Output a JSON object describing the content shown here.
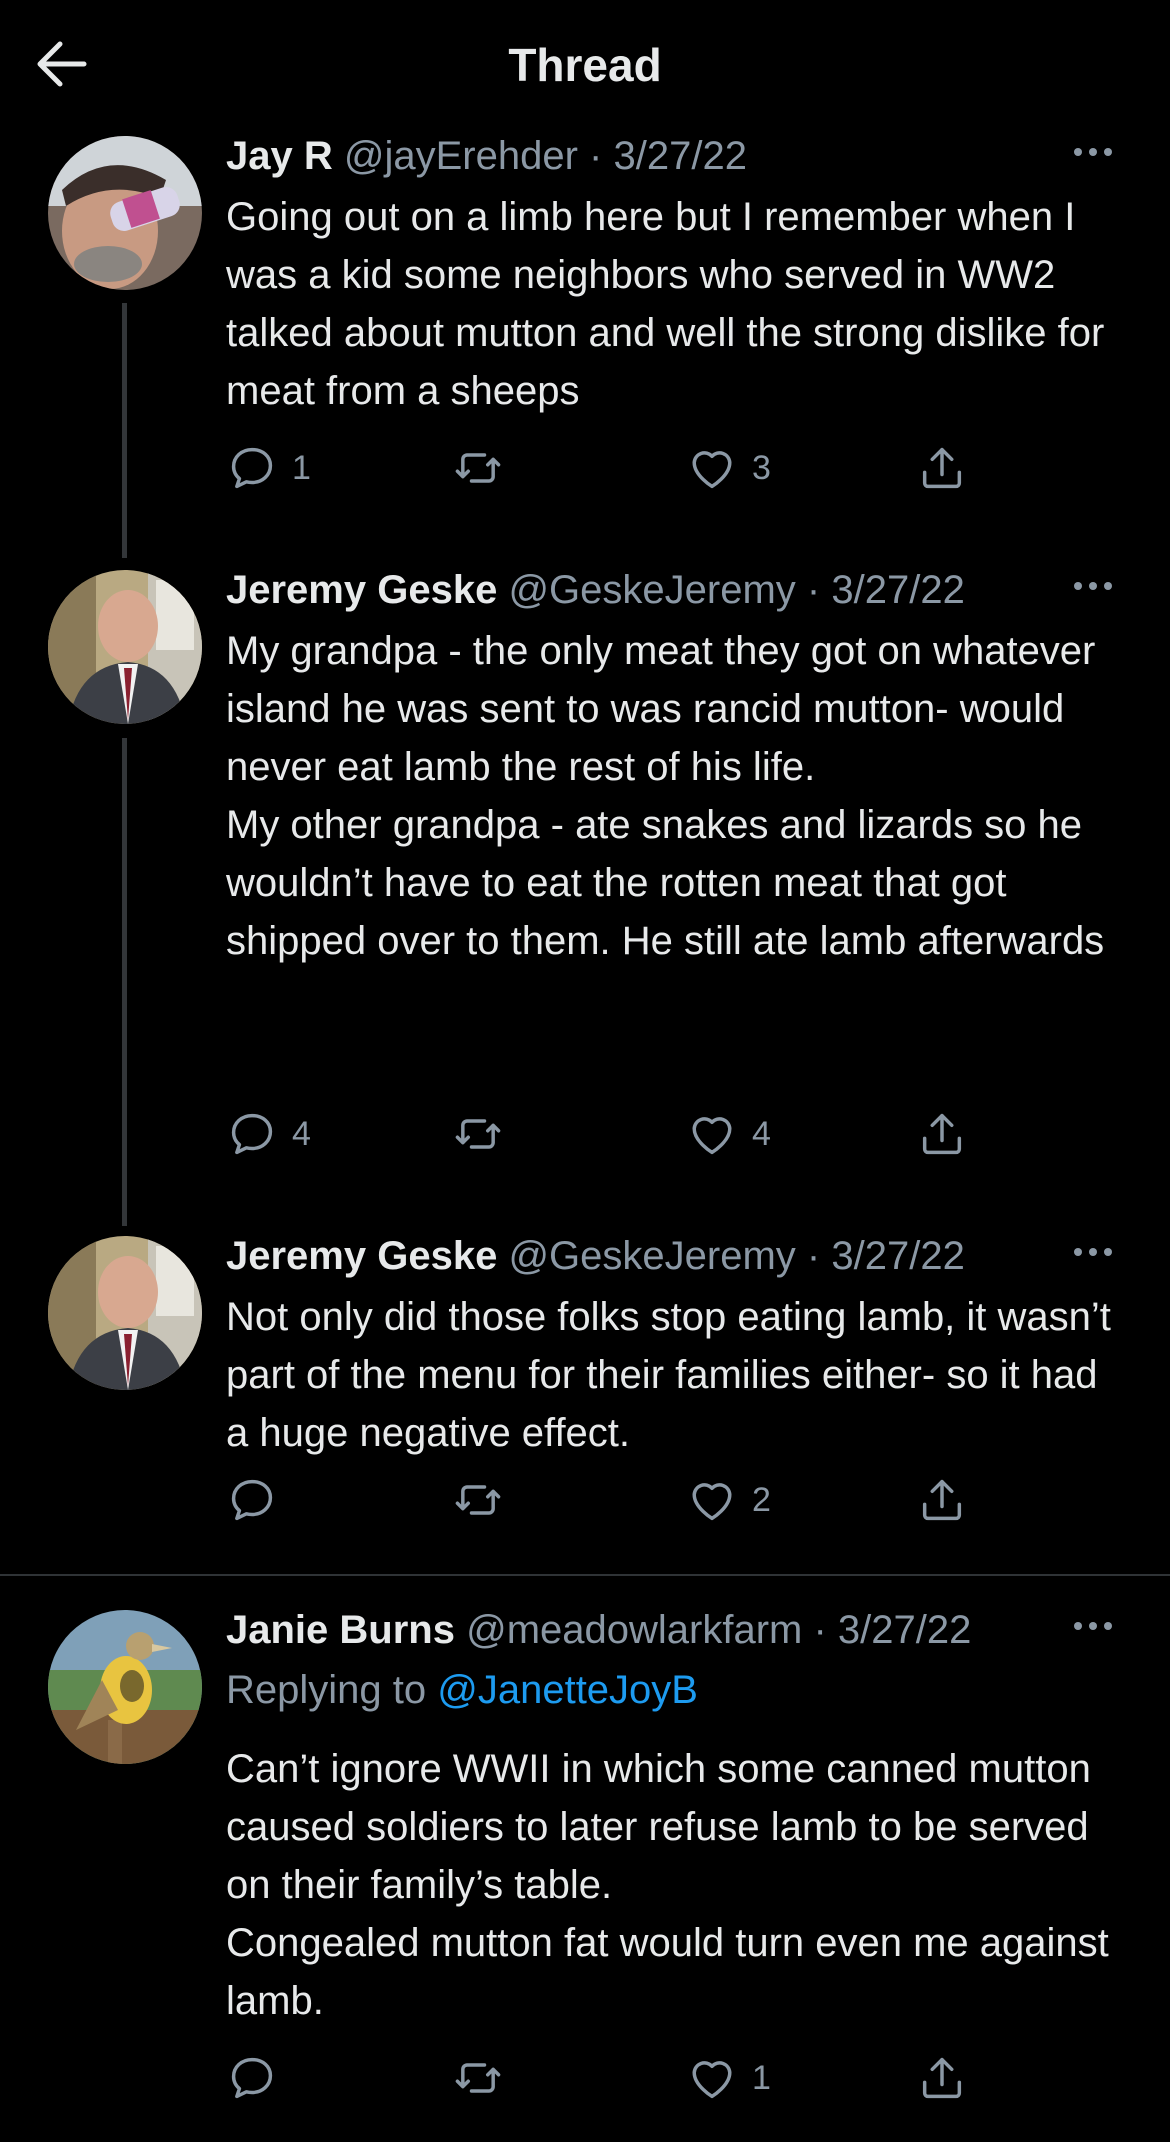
{
  "header": {
    "title": "Thread",
    "back_icon": "arrow-left-icon"
  },
  "tweets": [
    {
      "name": "Jay R",
      "handle": "@jayErehder",
      "sep": "·",
      "date": "3/27/22",
      "text": "Going out on a limb here but I remember when I was a kid some neighbors who served in WW2 talked about mutton and well the strong dislike for meat from a sheeps",
      "replies": "1",
      "retweets": "",
      "likes": "3"
    },
    {
      "name": "Jeremy Geske",
      "handle": "@GeskeJeremy",
      "sep": "·",
      "date": "3/27/22",
      "text": "My grandpa - the only meat they got on whatever island he was sent to was rancid mutton-  would never eat lamb the rest of his life.\nMy other grandpa - ate snakes and lizards so he wouldn’t have to eat the rotten meat that got shipped over to them. He still ate lamb afterwards",
      "replies": "4",
      "retweets": "",
      "likes": "4"
    },
    {
      "name": "Jeremy Geske",
      "handle": "@GeskeJeremy",
      "sep": "·",
      "date": "3/27/22",
      "text": "Not only did those folks stop eating lamb, it wasn’t part of the menu for their families either- so it had a huge negative effect.",
      "replies": "",
      "retweets": "",
      "likes": "2"
    },
    {
      "name": "Janie Burns",
      "handle": "@meadowlarkfarm",
      "sep": "·",
      "date": "3/27/22",
      "replying_prefix": "Replying to ",
      "replying_to": "@JanetteJoyB",
      "text": "Can’t ignore WWII in which some canned mutton caused soldiers to later refuse lamb to be served on their family’s table.\nCongealed mutton fat would turn even me against lamb.",
      "replies": "",
      "retweets": "",
      "likes": "1"
    }
  ],
  "colors": {
    "background": "#000000",
    "text": "#e7e9ea",
    "muted": "#8b98a5",
    "link": "#1d9bf0",
    "thread_line": "#333639"
  }
}
